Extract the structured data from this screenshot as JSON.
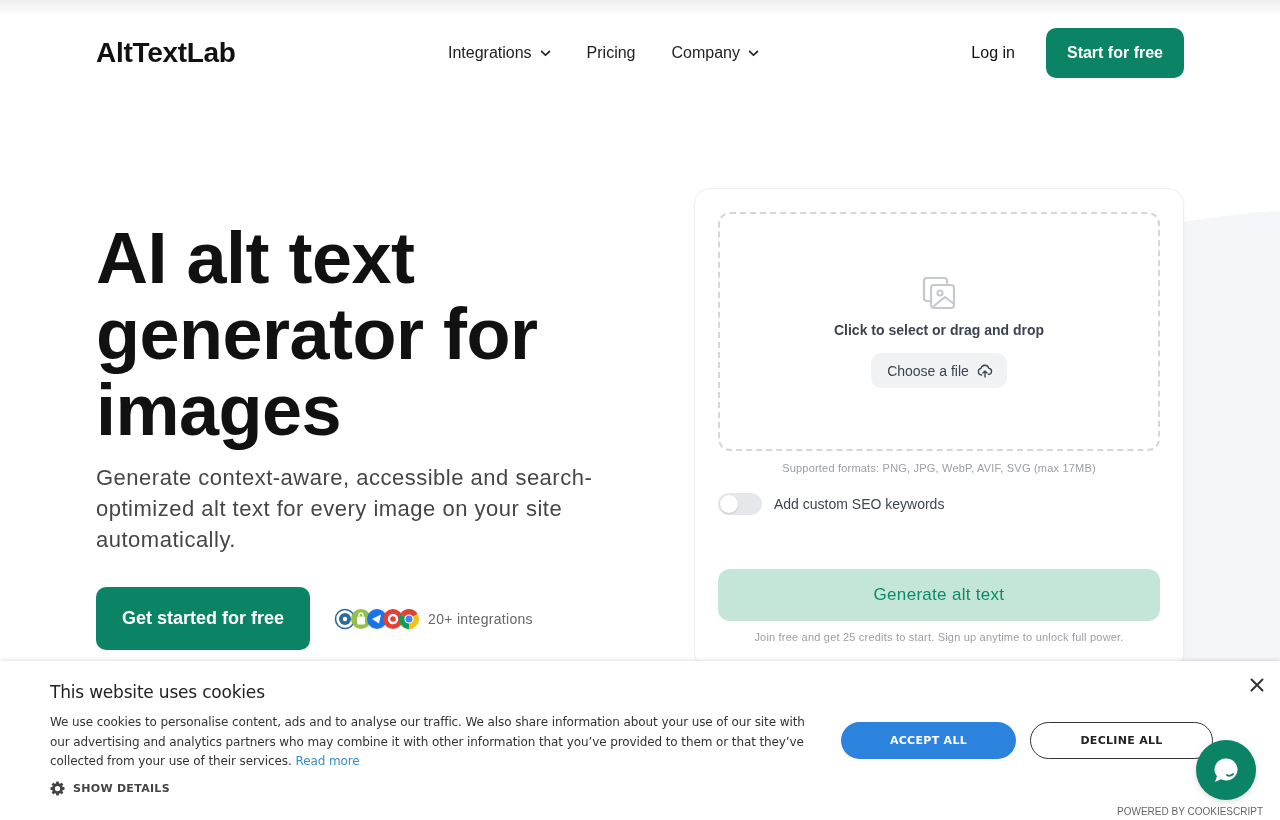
{
  "header": {
    "logo": "AltTextLab",
    "nav": [
      {
        "label": "Integrations",
        "has_dropdown": true
      },
      {
        "label": "Pricing",
        "has_dropdown": false
      },
      {
        "label": "Company",
        "has_dropdown": true
      }
    ],
    "login": "Log in",
    "cta": "Start for free"
  },
  "hero": {
    "title": "AI alt text generator for images",
    "subtitle": "Generate context-aware, accessible and search-optimized alt text for every image on your site automatically.",
    "cta": "Get started for free",
    "integrations_label": "20+ integrations"
  },
  "upload": {
    "prompt": "Click to select or drag and drop",
    "choose_button": "Choose a file",
    "formats_note": "Supported formats: PNG, JPG, WebP, AVIF, SVG (max 17MB)",
    "seo_toggle": {
      "label": "Add custom SEO keywords",
      "on": false
    },
    "generate_button": {
      "label": "Generate alt text",
      "disabled": true
    },
    "footnote": "Join free and get 25 credits to start. Sign up anytime to unlock full power."
  },
  "cookie_banner": {
    "title": "This website uses cookies",
    "text": "We use cookies to personalise content, ads and to analyse our traffic. We also share information about your use of our site with our advertising and analytics partners who may combine it with other information that you’ve provided to them or that they’ve collected from your use of their services.",
    "link": "Read more",
    "show_details": "SHOW DETAILS",
    "buttons": [
      {
        "label": "ACCEPT ALL",
        "kind": "primary"
      },
      {
        "label": "DECLINE ALL",
        "kind": "outline"
      }
    ],
    "powered_by": "POWERED BY COOKIESCRIPT"
  }
}
